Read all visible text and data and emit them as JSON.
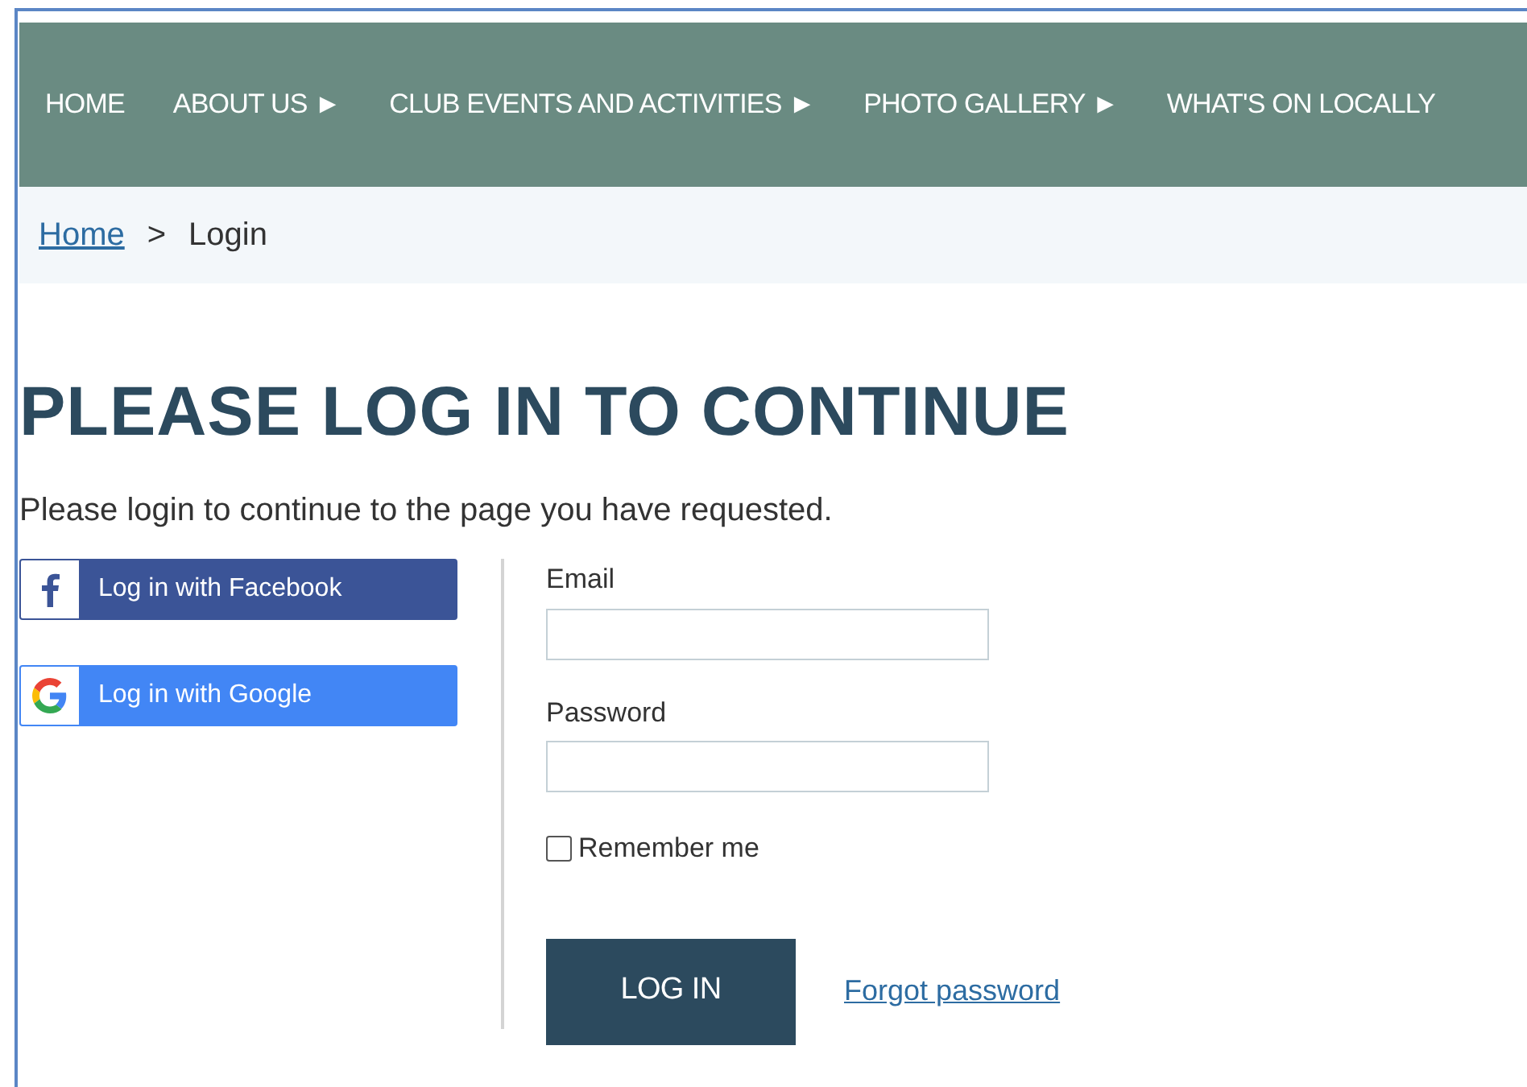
{
  "nav": [
    {
      "label": "HOME",
      "submenu": false
    },
    {
      "label": "ABOUT US",
      "submenu": true
    },
    {
      "label": "CLUB EVENTS AND ACTIVITIES",
      "submenu": true
    },
    {
      "label": "PHOTO GALLERY",
      "submenu": true
    },
    {
      "label": "WHAT'S ON LOCALLY",
      "submenu": false
    }
  ],
  "submenu_arrow": "►",
  "breadcrumb": {
    "link": "Home",
    "separator": ">",
    "current": "Login"
  },
  "heading": "PLEASE LOG IN TO CONTINUE",
  "intro": "Please login to continue to the page you have requested.",
  "social": [
    {
      "kind": "facebook",
      "label": "Log in with Facebook",
      "color": "#3b5497"
    },
    {
      "kind": "google",
      "label": "Log in with Google",
      "color": "#4286f5"
    }
  ],
  "form": {
    "email_label": "Email",
    "password_label": "Password",
    "remember": {
      "label": "Remember me",
      "checked": false
    },
    "submit": "LOG IN",
    "forgot": "Forgot password"
  }
}
